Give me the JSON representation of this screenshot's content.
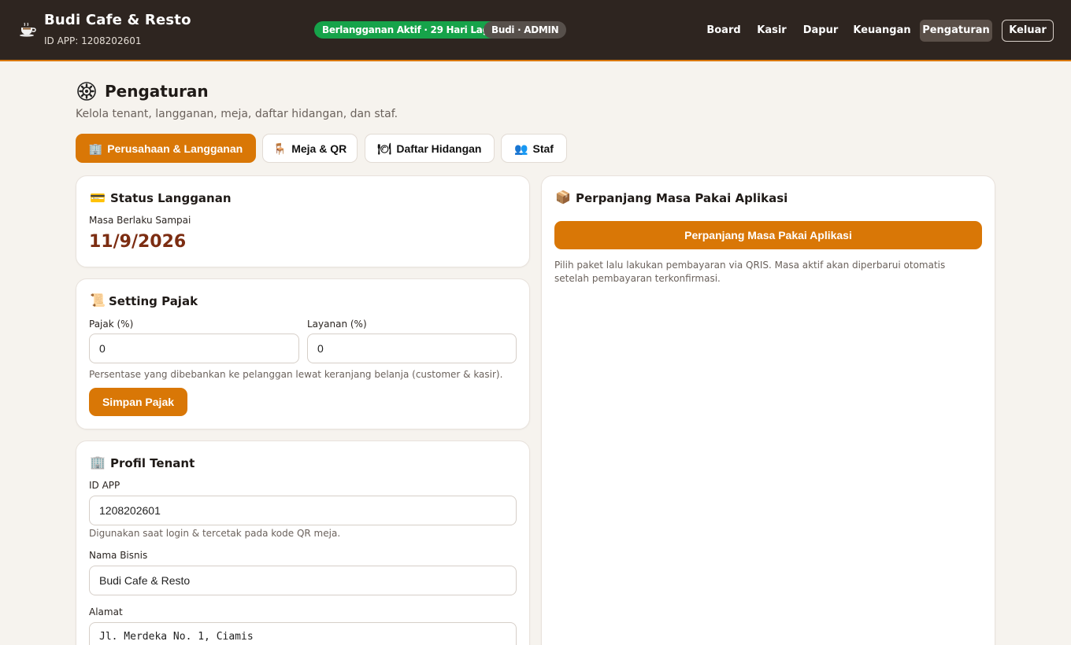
{
  "header": {
    "brand_icon": "coffee-cup-icon",
    "app_name": "Budi Cafe & Resto",
    "app_id_line": "ID APP: 1208202601",
    "subscription_badge": "Berlangganan Aktif · 29 Hari Lagi",
    "user_badge": "Budi · ADMIN",
    "nav": [
      "Board",
      "Kasir",
      "Dapur",
      "Keuangan",
      "Pengaturan"
    ],
    "active_nav": "Pengaturan",
    "logout_label": "Keluar",
    "colors": {
      "bar": "#2e2520",
      "accent_line": "#d97706",
      "badge_green": "#16a34a"
    }
  },
  "page": {
    "icon": "gear-icon",
    "title": "Pengaturan",
    "subtitle": "Kelola tenant, langganan, meja, daftar hidangan, dan staf."
  },
  "tabs": [
    {
      "icon": "office-building-icon",
      "label": "Perusahaan & Langganan",
      "active": true
    },
    {
      "icon": "chair-icon",
      "label": "Meja & QR",
      "active": false
    },
    {
      "icon": "dish-icon",
      "label": "Daftar Hidangan",
      "active": false
    },
    {
      "icon": "people-icon",
      "label": "Staf",
      "active": false
    }
  ],
  "subscription_card": {
    "icon": "credit-card-icon",
    "title": "Status Langganan",
    "label": "Masa Berlaku Sampai",
    "expiry_date": "11/9/2026"
  },
  "tax_card": {
    "icon": "receipt-icon",
    "title": "Setting Pajak",
    "tax_label": "Pajak (%)",
    "tax_value": "0",
    "service_label": "Layanan (%)",
    "service_value": "0",
    "hint": "Persentase yang dibebankan ke pelanggan lewat keranjang belanja (customer & kasir).",
    "save_label": "Simpan Pajak"
  },
  "profile_card": {
    "icon": "office-building-icon",
    "title": "Profil Tenant",
    "app_id_label": "ID APP",
    "app_id_value": "1208202601",
    "app_id_hint": "Digunakan saat login & tercetak pada kode QR meja.",
    "business_label": "Nama Bisnis",
    "business_value": "Budi Cafe & Resto",
    "address_label": "Alamat",
    "address_value": "Jl. Merdeka No. 1, Ciamis"
  },
  "extend_card": {
    "icon": "package-icon",
    "title": "Perpanjang Masa Pakai Aplikasi",
    "button_label": "Perpanjang Masa Pakai Aplikasi",
    "description": "Pilih paket lalu lakukan pembayaran via QRIS. Masa aktif akan diperbarui otomatis setelah pembayaran terkonfirmasi."
  },
  "accent_color": "#d97706"
}
